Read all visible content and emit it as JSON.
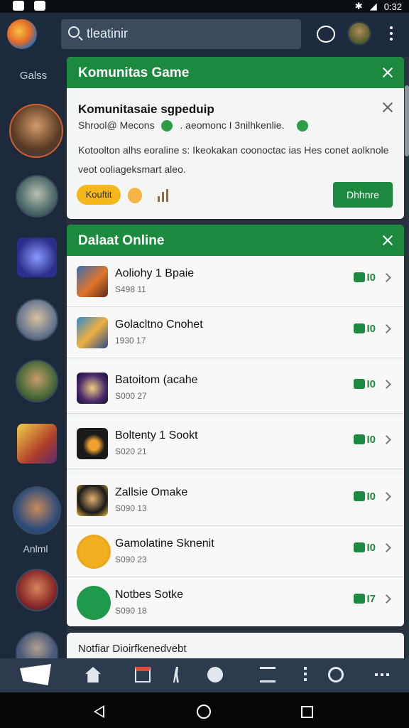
{
  "status": {
    "time": "0:32"
  },
  "search": {
    "value": "tleatinir"
  },
  "sidebar": {
    "top_label": "Galss",
    "bottom_label": "Anlml"
  },
  "notification": {
    "header": "Komunitas Game",
    "title": "Komunitasaie sgpeduip",
    "sub_left": "Shrool@ Mecons",
    "sub_right": ". aeomonc I 3nilhkenlie.",
    "body": "Kotoolton alhs eoraline s: Ikeokakan coonoctac ias Hes conet aolknole veot ooliageksmart aleo.",
    "pill": "Kouftit",
    "action": "Dhhnre"
  },
  "online": {
    "header": "Dalaat Online",
    "rows": [
      {
        "title": "Aoliohy 1 Bpaie",
        "meta": "S498 11",
        "count": "0"
      },
      {
        "title": "Golacltno Cnohet",
        "meta": "1930 17",
        "count": "0"
      },
      {
        "title": "Batoitom (acahe",
        "meta": "S000 27",
        "count": "0"
      },
      {
        "title": "Boltenty 1 Sookt",
        "meta": "S020 21",
        "count": "0"
      },
      {
        "title": "Zallsie  Omake",
        "meta": "S090 13",
        "count": "0"
      },
      {
        "title": "Gamolatine Sknenit",
        "meta": "S090 23",
        "count": "0"
      },
      {
        "title": "Notbes  Sotke",
        "meta": "S090 18",
        "count": "7"
      }
    ],
    "footer": "Notfiar Dioirfkenedvebt"
  }
}
